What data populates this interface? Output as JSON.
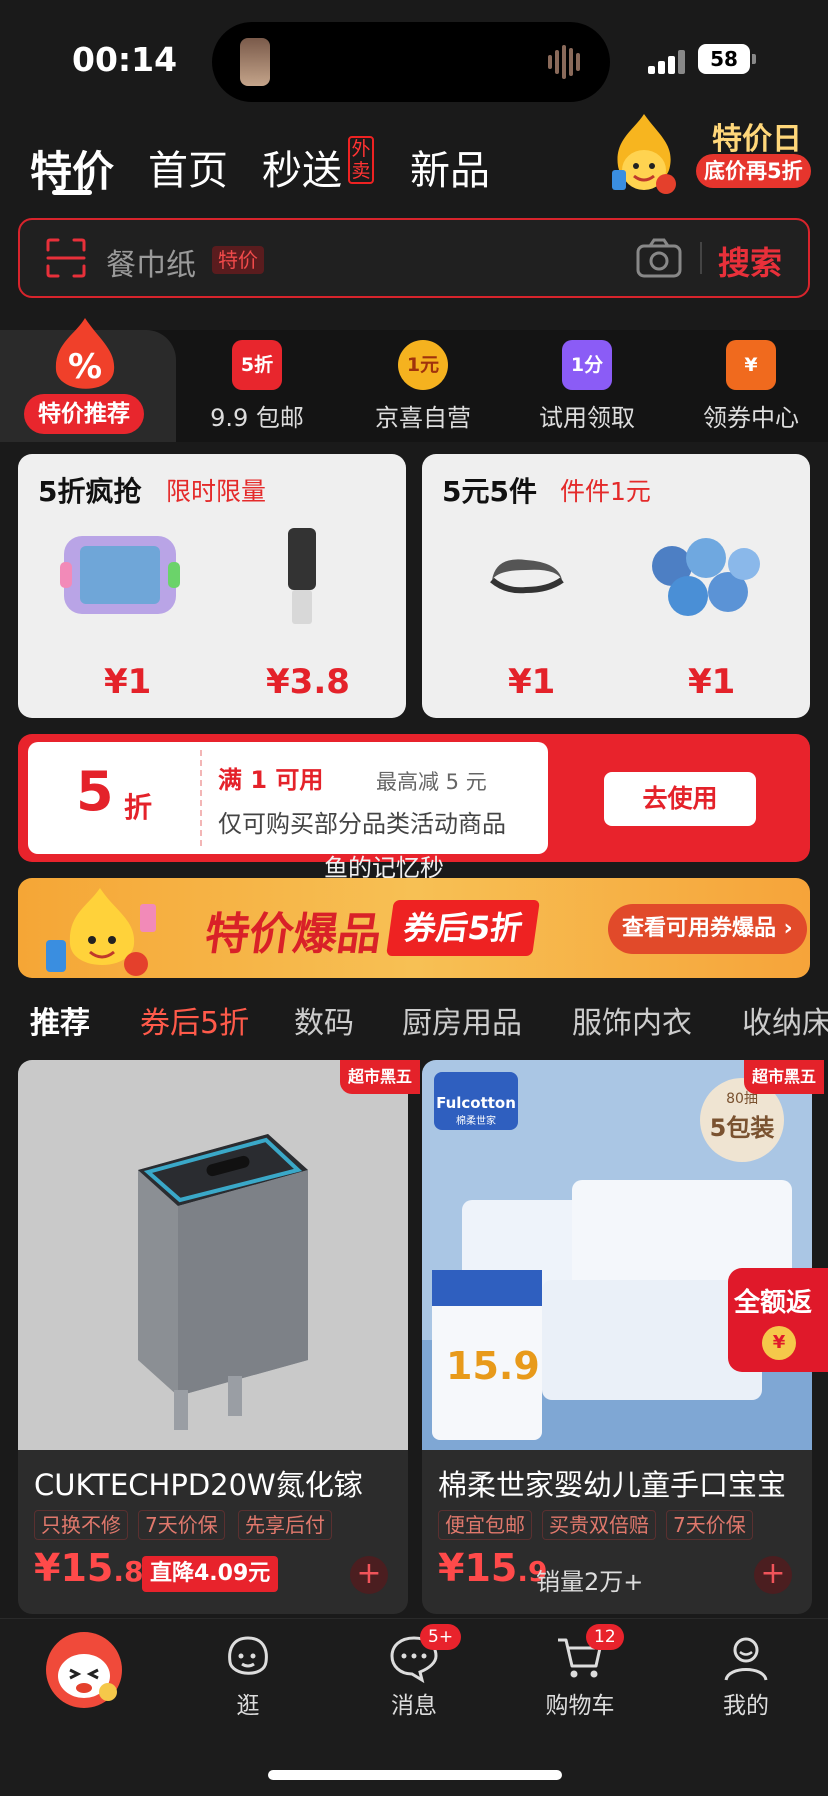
{
  "status": {
    "time": "00:14",
    "battery": "58"
  },
  "tabs": {
    "tejia": "特价",
    "shouye": "首页",
    "miaosong": "秒送",
    "waimai": "外卖",
    "xinpin": "新品"
  },
  "tejiari": {
    "title": "特价日",
    "badge": "底价再5折"
  },
  "search": {
    "placeholder": "餐巾纸",
    "tag": "特价",
    "button": "搜索"
  },
  "quicknav": {
    "active": "特价推荐",
    "items": [
      {
        "icon_text": "5折",
        "label": "9.9 包邮",
        "color": "#e8262d"
      },
      {
        "icon_text": "1元",
        "label": "京喜自营",
        "color": "#f5b21f"
      },
      {
        "icon_text": "1分",
        "label": "试用领取",
        "color": "#8b5cf6"
      },
      {
        "icon_text": "¥",
        "label": "领券中心",
        "color": "#f06a1e"
      }
    ]
  },
  "promos": [
    {
      "title": "5折疯抢",
      "sub": "限时限量",
      "prices": [
        "¥1",
        "¥3.8"
      ]
    },
    {
      "title": "5元5件",
      "sub": "件件1元",
      "prices": [
        "¥1",
        "¥1"
      ]
    }
  ],
  "coupon": {
    "discount": "5",
    "unit": "折",
    "condition": "满 1 可用",
    "max": "最高减 5 元",
    "desc": "仅可购买部分品类活动商品",
    "button": "去使用"
  },
  "watermark": "鱼的记忆秒",
  "banner": {
    "title": "特价爆品",
    "tag": "券后5折",
    "button": "查看可用券爆品 ›"
  },
  "categories": [
    "推荐",
    "券后5折",
    "数码",
    "厨房用品",
    "服饰内衣",
    "收纳床"
  ],
  "products": [
    {
      "badge": "超市黑五",
      "name": "CUKTECHPD20W氮化镓",
      "tags": [
        "只换不修",
        "7天价保",
        "先享后付"
      ],
      "price_int": "¥15",
      "price_dec": ".81",
      "extra": "直降4.09元"
    },
    {
      "badge": "超市黑五",
      "name": "棉柔世家婴幼儿童手口宝宝",
      "tags": [
        "便宜包邮",
        "买贵双倍赔",
        "7天价保"
      ],
      "price_int": "¥15",
      "price_dec": ".9",
      "extra": "销量2万+",
      "brand": "Fulcotton",
      "brand_sub": "棉柔世家",
      "pack": "5包装",
      "pack_top": "80抽",
      "price_tag": "15.9"
    }
  ],
  "fanli": {
    "label": "全额返",
    "coin": "¥"
  },
  "bottom_nav": {
    "guang": "逛",
    "xiaoxi": "消息",
    "xiaoxi_badge": "5+",
    "gouwuche": "购物车",
    "gouwuche_badge": "12",
    "wode": "我的"
  }
}
